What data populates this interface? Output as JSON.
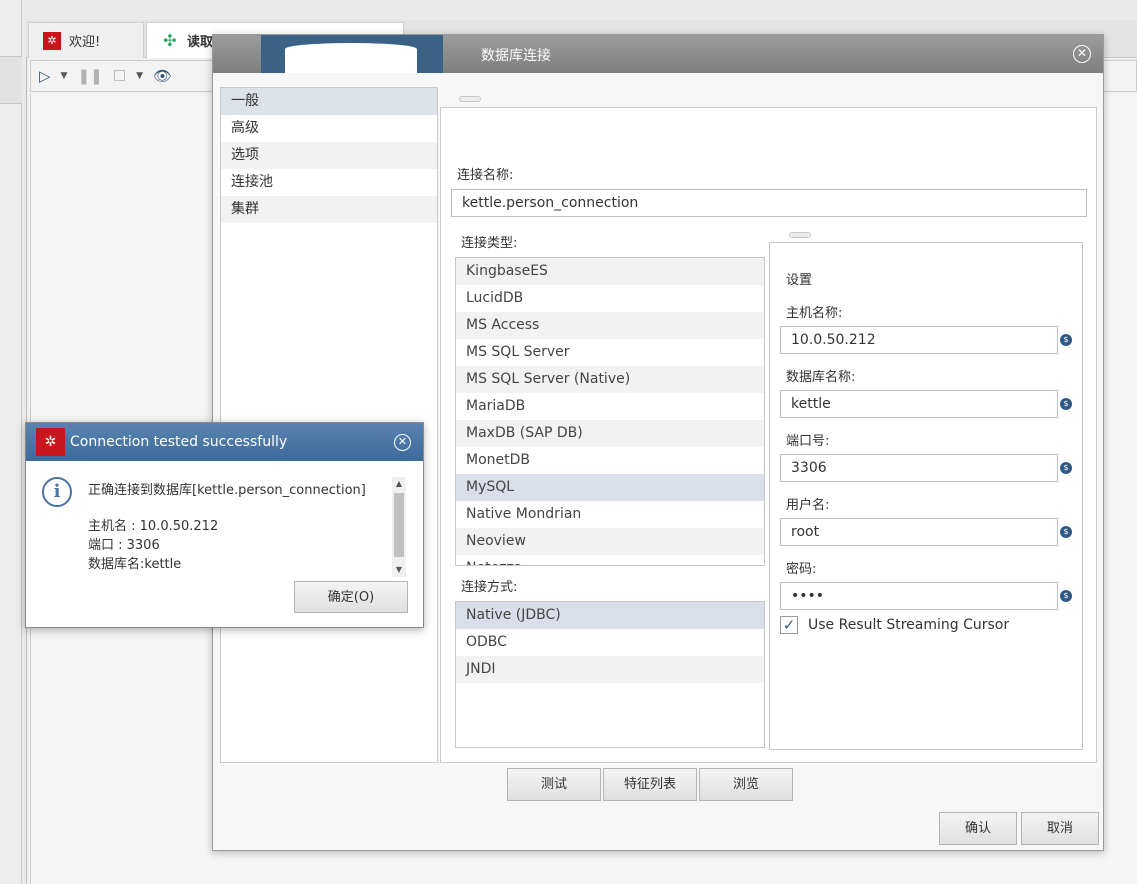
{
  "app": {
    "tabs": [
      {
        "label": "欢迎!"
      },
      {
        "label": "读取"
      }
    ]
  },
  "dialog": {
    "title": "数据库连接",
    "nav": [
      "一般",
      "高级",
      "选项",
      "连接池",
      "集群"
    ],
    "connection_name_label": "连接名称:",
    "connection_name_value": "kettle.person_connection",
    "connection_type_label": "连接类型:",
    "connection_types": [
      "KingbaseES",
      "LucidDB",
      "MS Access",
      "MS SQL Server",
      "MS SQL Server (Native)",
      "MariaDB",
      "MaxDB (SAP DB)",
      "MonetDB",
      "MySQL",
      "Native Mondrian",
      "Neoview",
      "Netezza"
    ],
    "selected_type": "MySQL",
    "access_label": "连接方式:",
    "access_methods": [
      "Native (JDBC)",
      "ODBC",
      "JNDI"
    ],
    "selected_access": "Native (JDBC)",
    "settings": {
      "header": "设置",
      "host_label": "主机名称:",
      "host_value": "10.0.50.212",
      "db_label": "数据库名称:",
      "db_value": "kettle",
      "port_label": "端口号:",
      "port_value": "3306",
      "user_label": "用户名:",
      "user_value": "root",
      "password_label": "密码:",
      "password_value": "••••",
      "streaming_cursor_label": "Use Result Streaming Cursor",
      "streaming_cursor_checked": true
    },
    "buttons": {
      "test": "测试",
      "features": "特征列表",
      "explore": "浏览",
      "ok": "确认",
      "cancel": "取消"
    }
  },
  "popup": {
    "title": "Connection tested successfully",
    "message_line1": "正确连接到数据库[kettle.person_connection]",
    "host_line": "主机名        : 10.0.50.212",
    "port_line": "端口            : 3306",
    "db_line": "数据库名:kettle",
    "ok_button": "确定(O)"
  },
  "colors": {
    "popup_title_bg": "#3c6a9a",
    "dialog_title_bg": "#8a8a8a",
    "selection_bg": "#d9dee8",
    "brand_red": "#c8161d"
  }
}
